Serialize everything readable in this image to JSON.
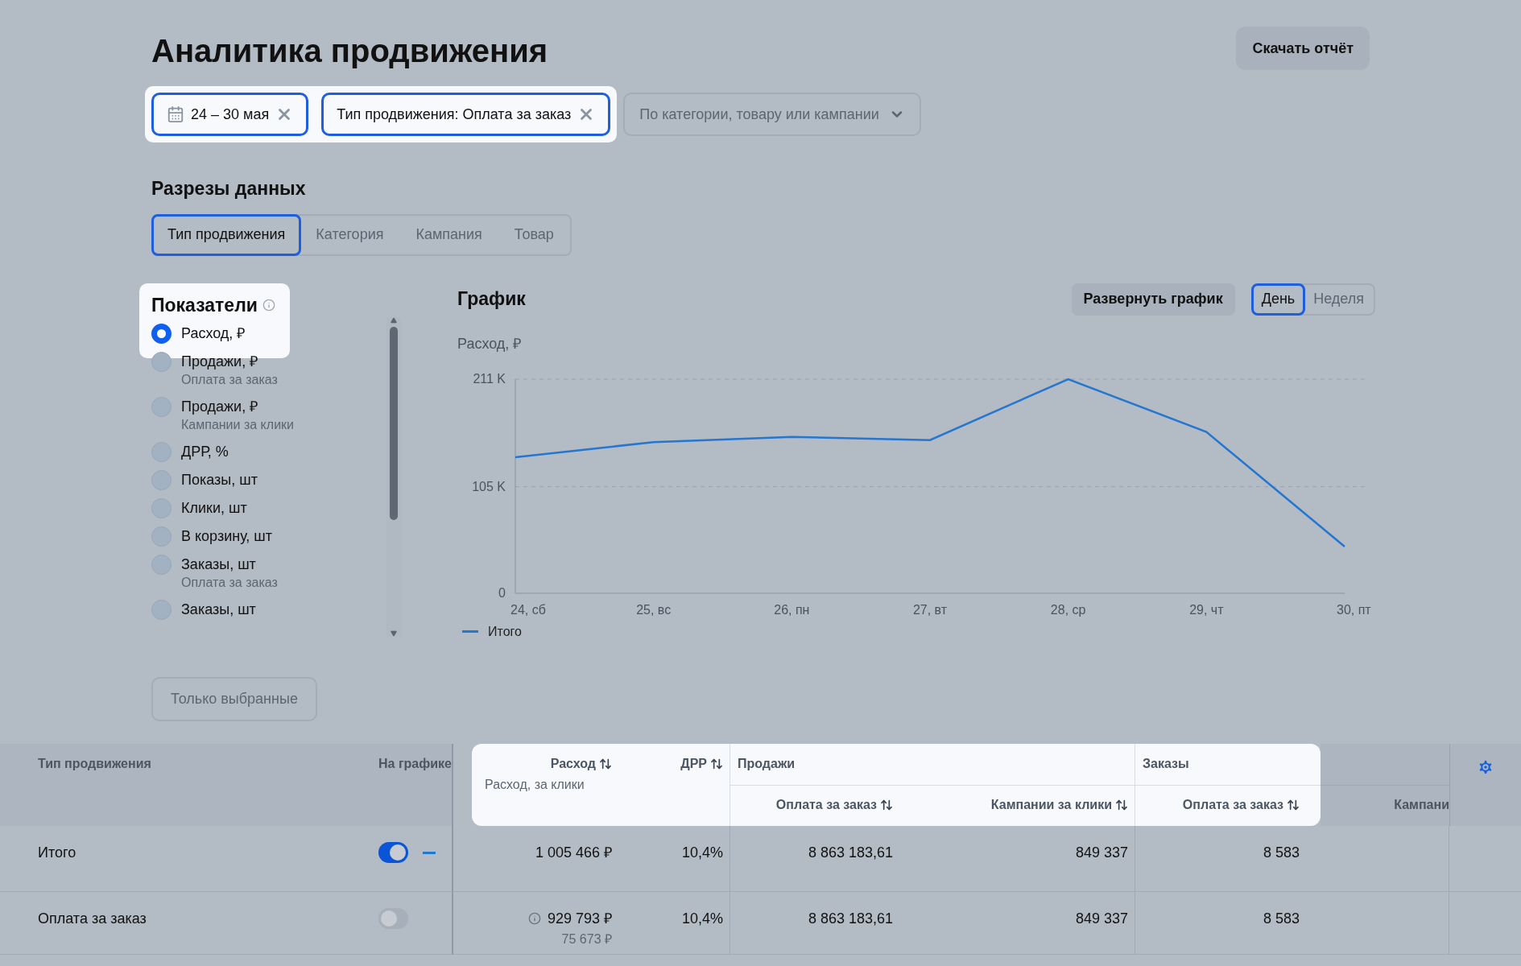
{
  "page_title": "Аналитика продвижения",
  "download_button": "Скачать отчёт",
  "filters": [
    {
      "kind": "date",
      "label": "24 – 30 мая"
    },
    {
      "kind": "tag",
      "label": "Тип продвижения: Оплата за заказ"
    }
  ],
  "search_dropdown": {
    "placeholder": "По категории, товару или кампании"
  },
  "slices": {
    "title": "Разрезы данных",
    "tabs": [
      {
        "label": "Тип продвижения",
        "selected": true
      },
      {
        "label": "Категория",
        "selected": false
      },
      {
        "label": "Кампания",
        "selected": false
      },
      {
        "label": "Товар",
        "selected": false
      }
    ]
  },
  "metrics": {
    "title": "Показатели",
    "items": [
      {
        "label": "Расход, ₽",
        "selected": true
      },
      {
        "label": "Продажи, ₽",
        "sublabel": "Оплата за заказ",
        "selected": false
      },
      {
        "label": "Продажи, ₽",
        "sublabel": "Кампании за клики",
        "selected": false
      },
      {
        "label": "ДРР, %",
        "selected": false
      },
      {
        "label": "Показы, шт",
        "selected": false
      },
      {
        "label": "Клики, шт",
        "selected": false
      },
      {
        "label": "В корзину, шт",
        "selected": false
      },
      {
        "label": "Заказы, шт",
        "sublabel": "Оплата за заказ",
        "selected": false
      },
      {
        "label": "Заказы, шт",
        "selected": false
      }
    ],
    "only_selected_button": "Только выбранные"
  },
  "chart": {
    "title": "График",
    "expand_button": "Развернуть график",
    "period_toggle": [
      {
        "label": "День",
        "selected": true
      },
      {
        "label": "Неделя",
        "selected": false
      }
    ],
    "chart_data": {
      "type": "line",
      "ylabel": "Расход, ₽",
      "categories": [
        "24, сб",
        "25, вс",
        "26, пн",
        "27, вт",
        "28, ср",
        "29, чт",
        "30, пт"
      ],
      "series": [
        {
          "name": "Итого",
          "color": "#2476d0",
          "values": [
            134,
            149,
            154,
            151,
            211,
            159,
            46
          ]
        }
      ],
      "ylim": [
        0,
        211
      ],
      "yticks": [
        {
          "value": 0,
          "label": "0"
        },
        {
          "value": 105,
          "label": "105 K"
        },
        {
          "value": 211,
          "label": "211 K"
        }
      ]
    }
  },
  "table": {
    "columns": {
      "type": "Тип продвижения",
      "on_chart": "На графике",
      "spend": "Расход",
      "spend_sub": "Расход, за клики",
      "drr": "ДРР",
      "sales_group": "Продажи",
      "sales_order": "Оплата за заказ",
      "sales_clicks": "Кампании за клики",
      "orders_group": "Заказы",
      "orders_order": "Оплата за заказ",
      "orders_clicks": "Кампани"
    },
    "rows": [
      {
        "name": "Итого",
        "on_chart": true,
        "spend": "1 005 466 ₽",
        "drr": "10,4%",
        "sales_order": "8 863 183,61",
        "sales_clicks": "849 337",
        "orders_order": "8 583"
      },
      {
        "name": "Оплата за заказ",
        "on_chart": false,
        "info": true,
        "spend": "929 793 ₽",
        "spend_sub": "75 673 ₽",
        "drr": "10,4%",
        "sales_order": "8 863 183,61",
        "sales_clicks": "849 337",
        "orders_order": "8 583"
      }
    ]
  }
}
